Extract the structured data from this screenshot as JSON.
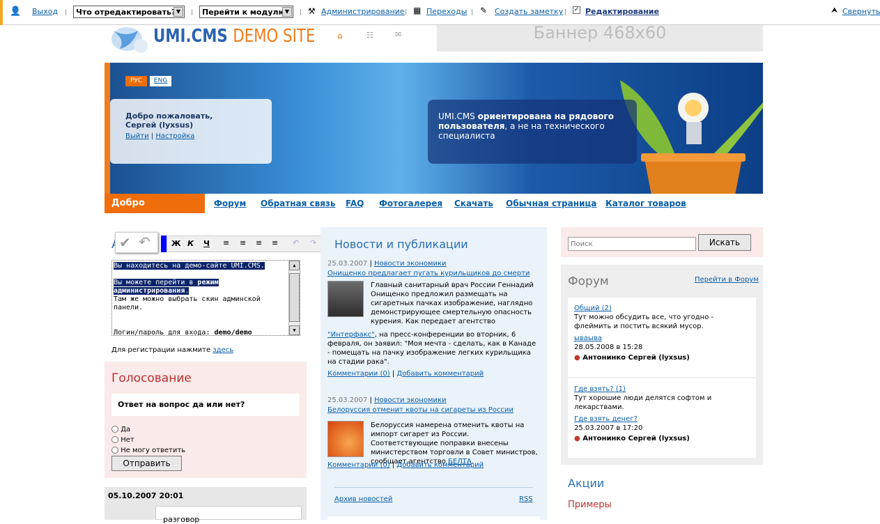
{
  "toolbar": {
    "logout": "Выход",
    "edit_select": "Что отредактировать?",
    "goto_select": "Перейти к модулю",
    "admin": "Администрирование",
    "transitions": "Переходы",
    "create_note": "Создать заметку",
    "editing": "Редактирование",
    "collapse": "Свернуть"
  },
  "header": {
    "logo_text": "UMI.CMS",
    "logo_sub": "DEMO SITE",
    "banner": "Баннер 468x60"
  },
  "lang": {
    "ru": "РУС",
    "en": "ENG"
  },
  "welcome": {
    "greeting": "Добро пожаловать,",
    "user": "Сергей (lyxsus)",
    "logout": "Выйти",
    "settings": "Настройка"
  },
  "slogan": {
    "part1": "UMI.CMS",
    "part2": "ориентирована на рядового пользователя",
    "part3": ", а не на технического специалиста"
  },
  "menu": {
    "active": "Добро пожаловать",
    "items": [
      "Форум",
      "Обратная связь",
      "FAQ",
      "Фотогалерея",
      "Скачать",
      "Обычная страница",
      "Каталог товаров"
    ]
  },
  "editor": {
    "title_fragment": "А",
    "bold": "Ж",
    "italic": "К",
    "underline": "Ч",
    "text1": "Вы находитесь на демо-сайте UMI.CMS.",
    "text2a": "Вы можете перейти в ",
    "text2b": "режим администрирования",
    "text2c": ".",
    "text3": "Там же можно выбрать скин админской панели.",
    "text4a": "Логин/пароль для входа: ",
    "text4b": "demo/demo",
    "reg_text": "Для регистрации нажмите ",
    "reg_link": "здесь"
  },
  "poll": {
    "title": "Голосование",
    "question": "Ответ на вопрос да или нет?",
    "options": [
      "Да",
      "Нет",
      "Не могу ответить"
    ],
    "submit": "Отправить"
  },
  "blog": {
    "date": "05.10.2007 20:01",
    "text": "разговор"
  },
  "news": {
    "title": "Новости и публикации",
    "items": [
      {
        "date": "25.03.2007",
        "category": "Новости экономики",
        "headline": "Онищенко предлагает пугать курильщиков до смерти",
        "body": "Главный санитарный врач России Геннадий Онищенко предложил размещать на сигаретных пачках изображение, наглядно демонстрирующее смертельную опасность курения. Как передает агентство ",
        "link": "\"Интерфакс\"",
        "body2": ", на пресс-конференции во вторник, 6 февраля, он заявил: \"Моя мечта - сделать, как в Канаде - помещать на пачку изображение легких курильщика на стадии рака\".",
        "comments": "Комментарии (0)",
        "add": "Добавить комментарий"
      },
      {
        "date": "25.03.2007",
        "category": "Новости экономики",
        "headline": "Белоруссия отменит квоты на сигареты из России",
        "body": "Белоруссия намерена отменить квоты на импорт сигарет из России. Соответствующие поправки внесены министерством торговли в Совет министров, сообщает агентство ",
        "link": "БЕЛТА",
        "body2": ".",
        "comments": "Комментарии (0)",
        "add": "Добавить комментарий"
      }
    ],
    "archive": "Архив новостей",
    "rss": "RSS"
  },
  "search": {
    "placeholder": "Поиск",
    "button": "Искать"
  },
  "forum": {
    "title": "Форум",
    "goto": "Перейти в Форум",
    "topics": [
      {
        "name": "Общий (2)",
        "desc": "Тут можно обсудить все, что угодно - флеймить и постить всякий мусор.",
        "last_title": "ываыва",
        "last_date": "28.05.2008 в 15:28",
        "author": "Антонинко Сергей (lyxsus)"
      },
      {
        "name": "Где взять? (1)",
        "desc": "Тут хорошие люди делятся софтом и лекарствами.",
        "last_title": "Где взять денег?",
        "last_date": "25.03.2007 в 17:20",
        "author": "Антонинко Сергей (lyxsus)"
      }
    ]
  },
  "promo": {
    "title": "Акции",
    "item": "Примеры"
  },
  "colors": {
    "accent": "#f06d0c",
    "link": "#0a5ea8",
    "poll_title": "#b92f2f"
  }
}
